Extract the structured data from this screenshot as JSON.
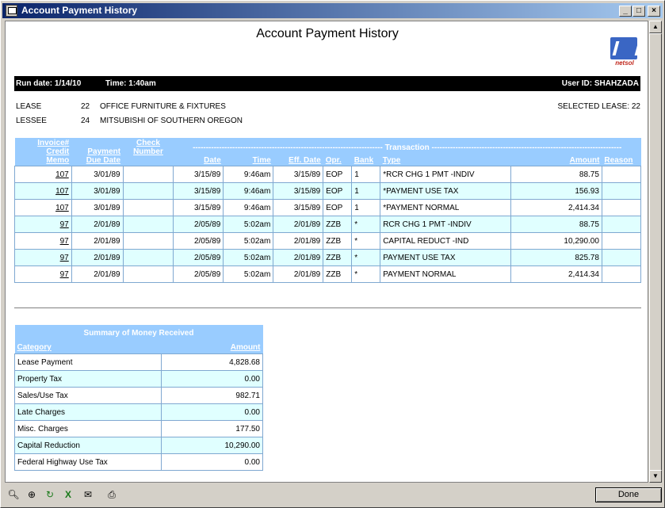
{
  "window": {
    "title": "Account Payment History"
  },
  "report": {
    "title": "Account Payment History",
    "logo_text": "netsol",
    "run_date": "Run date: 1/14/10",
    "time": "Time: 1:40am",
    "user_id": "User ID: SHAHZADA",
    "lease": {
      "label": "LEASE",
      "number": "22",
      "description": "OFFICE FURNITURE & FIXTURES"
    },
    "lessee": {
      "label": "LESSEE",
      "number": "24",
      "description": "MITSUBISHI OF SOUTHERN OREGON"
    },
    "selected_lease": "SELECTED LEASE: 22"
  },
  "transactions": {
    "headers": {
      "invoice": [
        "Invoice#",
        "Credit",
        "Memo"
      ],
      "payment_due": [
        "Payment",
        "Due Date"
      ],
      "check": [
        "Check",
        "Number"
      ],
      "transaction": "------------------------------------------------------------------------ Transaction ------------------------------------------------------------------------",
      "date": "Date",
      "time": "Time",
      "eff_date": "Eff. Date",
      "opr": "Opr.",
      "bank": "Bank",
      "type": "Type",
      "amount": "Amount",
      "reason": "Reason"
    },
    "rows": [
      {
        "invoice": "107",
        "due": "3/01/89",
        "check": "",
        "date": "3/15/89",
        "time": "9:46am",
        "eff": "3/15/89",
        "opr": "EOP",
        "bank": "1",
        "type": "*RCR CHG 1 PMT -INDIV",
        "amount": "88.75",
        "reason": ""
      },
      {
        "invoice": "107",
        "due": "3/01/89",
        "check": "",
        "date": "3/15/89",
        "time": "9:46am",
        "eff": "3/15/89",
        "opr": "EOP",
        "bank": "1",
        "type": "*PAYMENT USE TAX",
        "amount": "156.93",
        "reason": ""
      },
      {
        "invoice": "107",
        "due": "3/01/89",
        "check": "",
        "date": "3/15/89",
        "time": "9:46am",
        "eff": "3/15/89",
        "opr": "EOP",
        "bank": "1",
        "type": "*PAYMENT NORMAL",
        "amount": "2,414.34",
        "reason": ""
      },
      {
        "invoice": "97",
        "due": "2/01/89",
        "check": "",
        "date": "2/05/89",
        "time": "5:02am",
        "eff": "2/01/89",
        "opr": "ZZB",
        "bank": "*",
        "type": "RCR CHG 1 PMT -INDIV",
        "amount": "88.75",
        "reason": ""
      },
      {
        "invoice": "97",
        "due": "2/01/89",
        "check": "",
        "date": "2/05/89",
        "time": "5:02am",
        "eff": "2/01/89",
        "opr": "ZZB",
        "bank": "*",
        "type": "CAPITAL REDUCT -IND",
        "amount": "10,290.00",
        "reason": ""
      },
      {
        "invoice": "97",
        "due": "2/01/89",
        "check": "",
        "date": "2/05/89",
        "time": "5:02am",
        "eff": "2/01/89",
        "opr": "ZZB",
        "bank": "*",
        "type": "PAYMENT USE TAX",
        "amount": "825.78",
        "reason": ""
      },
      {
        "invoice": "97",
        "due": "2/01/89",
        "check": "",
        "date": "2/05/89",
        "time": "5:02am",
        "eff": "2/01/89",
        "opr": "ZZB",
        "bank": "*",
        "type": "PAYMENT NORMAL",
        "amount": "2,414.34",
        "reason": ""
      }
    ]
  },
  "summary": {
    "title": "Summary of Money Received",
    "category_header": "Category",
    "amount_header": "Amount",
    "rows": [
      {
        "category": "Lease Payment",
        "amount": "4,828.68"
      },
      {
        "category": "Property Tax",
        "amount": "0.00"
      },
      {
        "category": "Sales/Use Tax",
        "amount": "982.71"
      },
      {
        "category": "Late Charges",
        "amount": "0.00"
      },
      {
        "category": "Misc. Charges",
        "amount": "177.50"
      },
      {
        "category": "Capital Reduction",
        "amount": "10,290.00"
      },
      {
        "category": "Federal Highway Use Tax",
        "amount": "0.00"
      }
    ]
  },
  "toolbar": {
    "tools": [
      "zoom-out-icon",
      "zoom-in-icon",
      "refresh-icon",
      "excel-icon",
      "export-icon",
      "print-icon"
    ],
    "done_label": "Done"
  },
  "colors": {
    "header_bg": "#99ccff",
    "row_shade": "#e0ffff",
    "titlebar": "#0a246a"
  }
}
